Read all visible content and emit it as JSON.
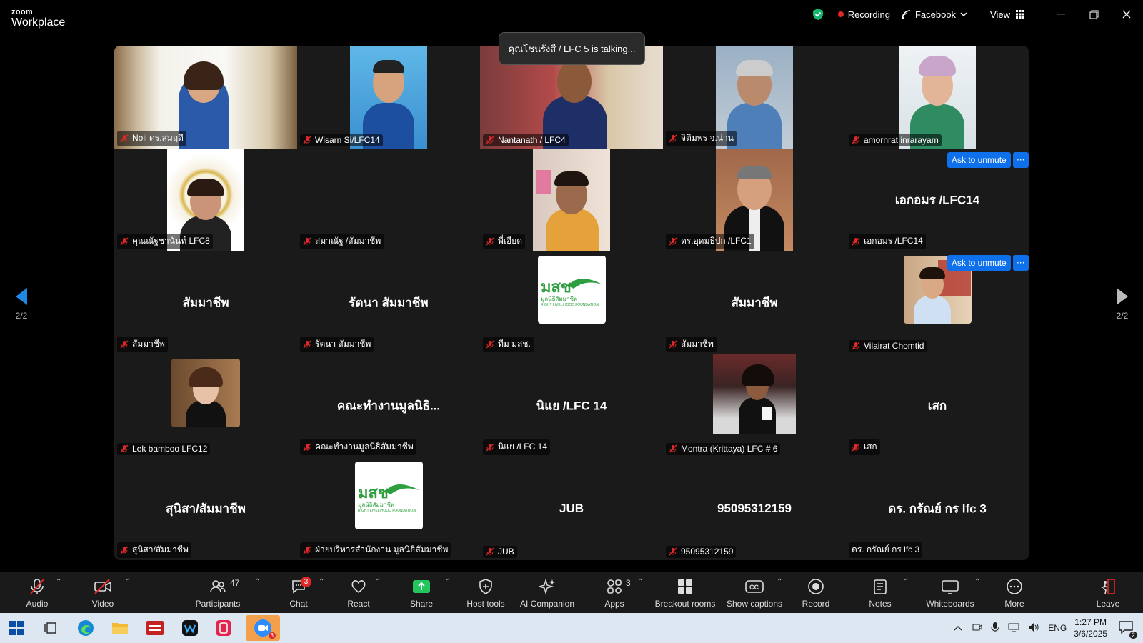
{
  "app": {
    "brand_small": "zoom",
    "brand_name": "Workplace"
  },
  "titlebar": {
    "recording_label": "Recording",
    "stream_label": "Facebook",
    "view_label": "View"
  },
  "colors": {
    "accent": "#0e71eb",
    "mute_red": "#e02828",
    "tile_bg": "#1a1a1a",
    "shield_green": "#12b76a"
  },
  "talking": "คุณโชนรังสี / LFC 5 is talking...",
  "gallery": {
    "page_indicator_left": "2/2",
    "page_indicator_right": "2/2",
    "tiles": [
      {
        "name": "Noii ดร.สมฤดี",
        "display": "",
        "has_video": true
      },
      {
        "name": "Wisarn Si/LFC14",
        "display": "",
        "has_video": true
      },
      {
        "name": "Nantanath / LFC4",
        "display": "",
        "has_video": true
      },
      {
        "name": "จิติมพร จ.น่าน",
        "display": "",
        "has_video": true
      },
      {
        "name": "amornrat inrarayam",
        "display": "",
        "has_video": true
      },
      {
        "name": "คุณณัฐชานันท์ LFC8",
        "display": "",
        "has_video": true
      },
      {
        "name": "สมาณัฐ /สัมมาชีพ",
        "display": "",
        "has_video": false
      },
      {
        "name": "พี่เอียด",
        "display": "",
        "has_video": true
      },
      {
        "name": "ดร.อุดมธิปก /LFC1",
        "display": "",
        "has_video": true
      },
      {
        "name": "เอกอมร /LFC14",
        "display": "เอกอมร /LFC14",
        "has_video": false
      },
      {
        "name": "สัมมาชีพ",
        "display": "สัมมาชีพ",
        "has_video": false
      },
      {
        "name": "รัตนา สัมมาชีพ",
        "display": "รัตนา สัมมาชีพ",
        "has_video": false
      },
      {
        "name": "ทีม มสช.",
        "display": "",
        "has_video": false
      },
      {
        "name": "สัมมาชีพ",
        "display": "สัมมาชีพ",
        "has_video": false
      },
      {
        "name": "Vilairat Chomtid",
        "display": "",
        "has_video": false
      },
      {
        "name": "Lek bamboo LFC12",
        "display": "",
        "has_video": false
      },
      {
        "name": "คณะทำงานมูลนิธิสัมมาชีพ",
        "display": "คณะทำงานมูลนิธิ...",
        "has_video": false
      },
      {
        "name": "นิแย /LFC 14",
        "display": "นิแย /LFC 14",
        "has_video": false
      },
      {
        "name": "Montra (Krittaya) LFC # 6",
        "display": "",
        "has_video": false
      },
      {
        "name": "เสก",
        "display": "เสก",
        "has_video": false
      },
      {
        "name": "สุนิสา/สัมมาชีพ",
        "display": "สุนิสา/สัมมาชีพ",
        "has_video": false
      },
      {
        "name": "ฝ่ายบริหารสำนักงาน มูลนิธิสัมมาชีพ",
        "display": "",
        "has_video": false
      },
      {
        "name": "JUB",
        "display": "JUB",
        "has_video": false
      },
      {
        "name": "95095312159",
        "display": "95095312159",
        "has_video": false
      },
      {
        "name": "ดร. กรัณย์ กร lfc 3",
        "display": "ดร. กรัณย์ กร lfc 3",
        "has_video": false
      }
    ],
    "ask_to_unmute_label": "Ask to unmute",
    "logo_text_main": "มสช",
    "logo_text_sub": "มูลนิธิสัมมาชีพ",
    "logo_text_en": "RIGHT LIVELIHOOD FOUNDATION"
  },
  "toolbar": {
    "audio": "Audio",
    "video": "Video",
    "participants": "Participants",
    "participants_count": "47",
    "chat": "Chat",
    "chat_badge": "3",
    "react": "React",
    "share": "Share",
    "host_tools": "Host tools",
    "ai_companion": "AI Companion",
    "apps": "Apps",
    "apps_count": "3",
    "breakout": "Breakout rooms",
    "captions": "Show captions",
    "record": "Record",
    "notes": "Notes",
    "whiteboards": "Whiteboards",
    "more": "More",
    "leave": "Leave"
  },
  "taskbar": {
    "lang": "ENG",
    "time": "1:27 PM",
    "date": "3/6/2025",
    "zoom_badge": "3",
    "notif_count": "2"
  }
}
